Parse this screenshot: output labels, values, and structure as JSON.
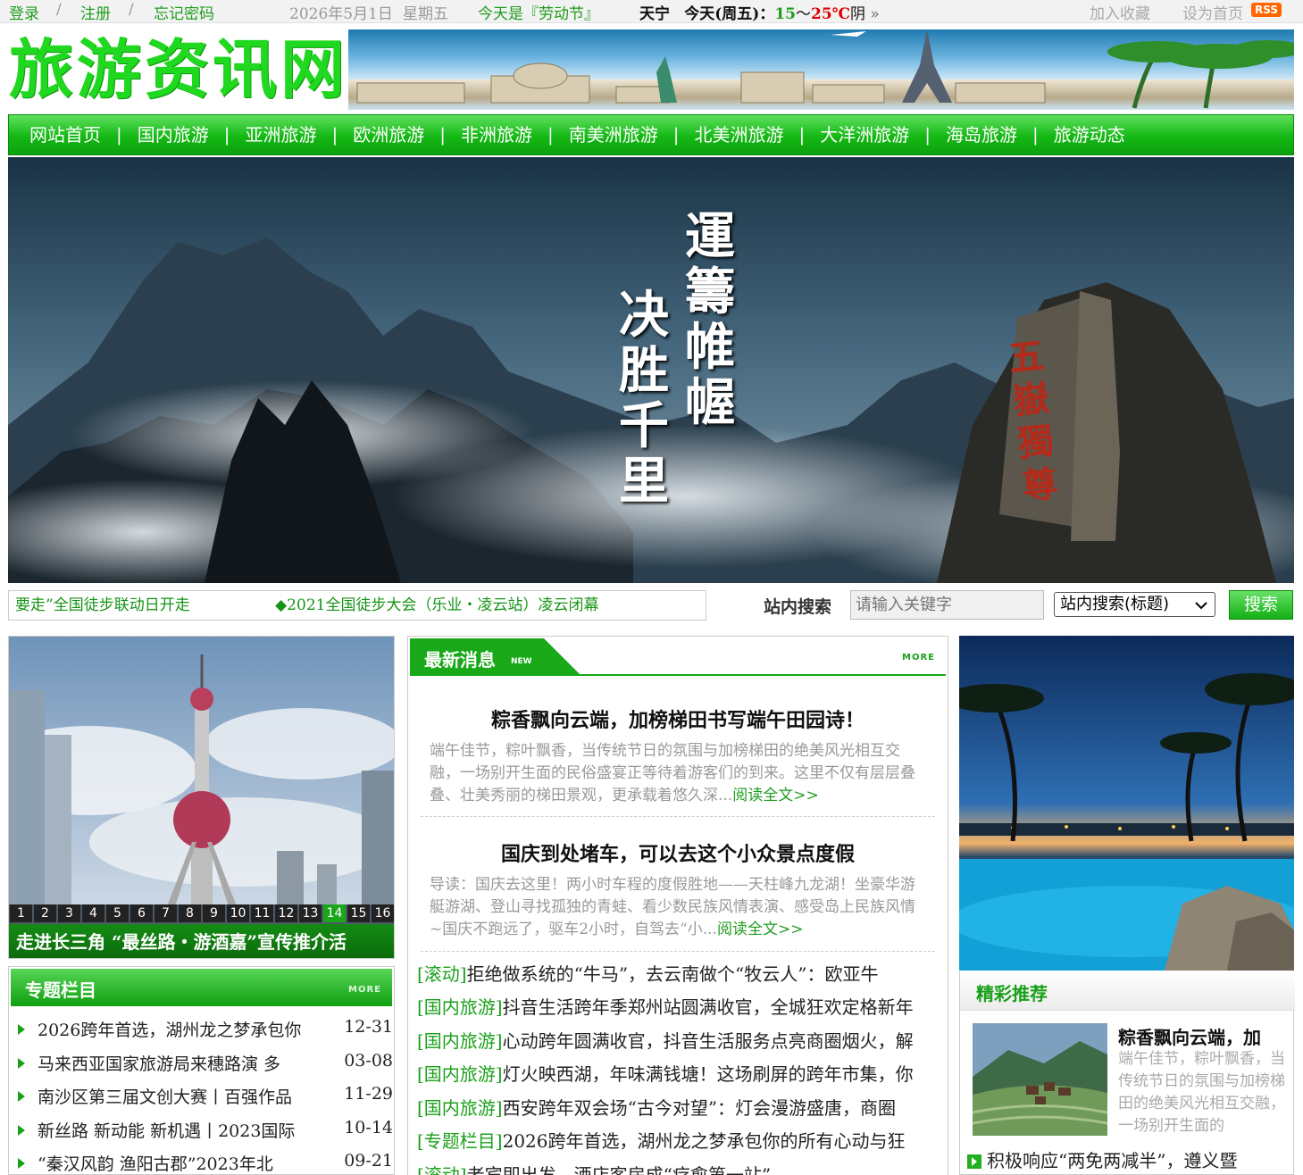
{
  "topbar": {
    "login": "登录",
    "sep": "/",
    "register": "注册",
    "forgot": "忘记密码",
    "date": "2026年5月1日",
    "weekday": "星期五",
    "holiday": "今天是『劳动节』",
    "city": "天宁",
    "today_label": "今天(周五)：",
    "temp_low": "15",
    "temp_tilde": "～",
    "temp_high": "25℃",
    "weather": "阴",
    "more_glyph": "»",
    "favorite": "加入收藏",
    "homepage": "设为首页",
    "rss": "RSS",
    "colors": {
      "low": "#1f9d1f",
      "high": "#e00000"
    }
  },
  "header": {
    "logo": "旅游资讯网",
    "logo_color": "#1fd81f"
  },
  "nav": {
    "separator": "|",
    "items": [
      "网站首页",
      "国内旅游",
      "亚洲旅游",
      "欧洲旅游",
      "非洲旅游",
      "南美洲旅游",
      "北美洲旅游",
      "大洋洲旅游",
      "海岛旅游",
      "旅游动态"
    ]
  },
  "hero": {
    "calligraphy_right": "運籌帷幄",
    "calligraphy_left": "决胜千里",
    "stone_text": "五嶽獨尊"
  },
  "ticker": {
    "item1": "要走”全国徒步联动日开走",
    "item2": "◆2021全国徒步大会（乐业・凌云站）凌云闭幕"
  },
  "search": {
    "label": "站内搜索",
    "placeholder": "请输入关键字",
    "scope": "站内搜索(标题)",
    "button": "搜索"
  },
  "slideshow": {
    "numbers": [
      "1",
      "2",
      "3",
      "4",
      "5",
      "6",
      "7",
      "8",
      "9",
      "10",
      "11",
      "12",
      "13",
      "14",
      "15",
      "16"
    ],
    "active": "14",
    "caption": "走进长三角 “最丝路・游酒嘉”宣传推介活"
  },
  "topics": {
    "title": "专题栏目",
    "more": "MORE",
    "items": [
      {
        "text": "2026跨年首选，湖州龙之梦承包你",
        "date": "12-31"
      },
      {
        "text": "马来西亚国家旅游局来穗路演 多",
        "date": "03-08"
      },
      {
        "text": "南沙区第三届文创大赛丨百强作品",
        "date": "11-29"
      },
      {
        "text": "新丝路 新动能 新机遇丨2023国际",
        "date": "10-14"
      },
      {
        "text": "“秦汉风韵 渔阳古郡”2023年北",
        "date": "09-21"
      }
    ]
  },
  "latest": {
    "title": "最新消息",
    "badge": "NEW",
    "more": "MORE",
    "articles": [
      {
        "headline": "粽香飘向云端，加榜梯田书写端午田园诗！",
        "summary": "端午佳节，粽叶飘香，当传统节日的氛围与加榜梯田的绝美风光相互交融，一场别开生面的民俗盛宴正等待着游客们的到来。这里不仅有层层叠叠、壮美秀丽的梯田景观，更承载着悠久深...",
        "read_more": "阅读全文>>"
      },
      {
        "headline": "国庆到处堵车，可以去这个小众景点度假",
        "summary": "导读：国庆去这里！两小时车程的度假胜地——天柱峰九龙湖！坐豪华游艇游湖、登山寻找孤独的青蛙、看少数民族风情表演、感受岛上民族风情~国庆不跑远了，驱车2小时，自驾去“小...",
        "read_more": "阅读全文>>"
      }
    ],
    "news": [
      {
        "cat": "[滚动]",
        "text": "拒绝做系统的“牛马”，去云南做个“牧云人”：欧亚牛"
      },
      {
        "cat": "[国内旅游]",
        "text": "抖音生活跨年季郑州站圆满收官，全城狂欢定格新年"
      },
      {
        "cat": "[国内旅游]",
        "text": "心动跨年圆满收官，抖音生活服务点亮商圈烟火，解"
      },
      {
        "cat": "[国内旅游]",
        "text": "灯火映西湖，年味满钱塘！这场刷屏的跨年市集，你"
      },
      {
        "cat": "[国内旅游]",
        "text": "西安跨年双会场“古今对望”：灯会漫游盛唐，商圈"
      },
      {
        "cat": "[专题栏目]",
        "text": "2026跨年首选，湖州龙之梦承包你的所有心动与狂"
      },
      {
        "cat": "[滚动]",
        "text": "老宾即出发，酒店客房成“疗愈第一站”"
      }
    ]
  },
  "recommend": {
    "title": "精彩推荐",
    "item_title": "粽香飘向云端，加",
    "item_desc": "端午佳节，粽叶飘香，当传统节日的氛围与加榜梯田的绝美风光相互交融，一场别开生面的",
    "list_item": "积极响应“两免两减半”，遵义暨"
  }
}
